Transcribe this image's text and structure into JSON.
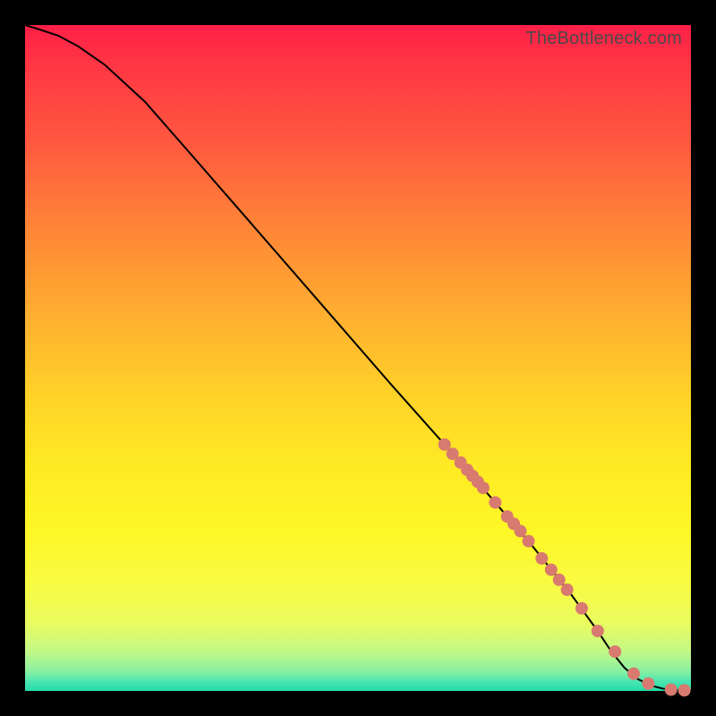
{
  "watermark": "TheBottleneck.com",
  "chart_data": {
    "type": "line",
    "title": "",
    "xlabel": "",
    "ylabel": "",
    "xlim": [
      0,
      100
    ],
    "ylim": [
      0,
      100
    ],
    "series": [
      {
        "name": "curve",
        "x": [
          0,
          2,
          5,
          8,
          12,
          18,
          25,
          35,
          45,
          55,
          63,
          70,
          76,
          82,
          86,
          88,
          90,
          92,
          94,
          96,
          98,
          100
        ],
        "y": [
          100,
          99.4,
          98.4,
          96.8,
          94.0,
          88.5,
          80.5,
          69.0,
          57.5,
          46.0,
          37.0,
          29.0,
          22.0,
          14.5,
          9.0,
          6.0,
          3.5,
          1.8,
          0.8,
          0.3,
          0.15,
          0.1
        ]
      }
    ],
    "markers": {
      "name": "highlighted-points",
      "color": "#d87a6f",
      "x": [
        63,
        64.2,
        65.4,
        66.4,
        67.2,
        68.0,
        68.8,
        70.6,
        72.4,
        73.4,
        74.4,
        75.6,
        77.6,
        79.0,
        80.2,
        81.4,
        83.6,
        86.0,
        88.6,
        91.4,
        93.6,
        97.0,
        99.0
      ],
      "y": [
        37.0,
        35.6,
        34.3,
        33.2,
        32.3,
        31.4,
        30.5,
        28.3,
        26.2,
        25.1,
        24.0,
        22.5,
        19.9,
        18.2,
        16.7,
        15.2,
        12.4,
        9.0,
        5.9,
        2.6,
        1.1,
        0.2,
        0.1
      ]
    }
  }
}
